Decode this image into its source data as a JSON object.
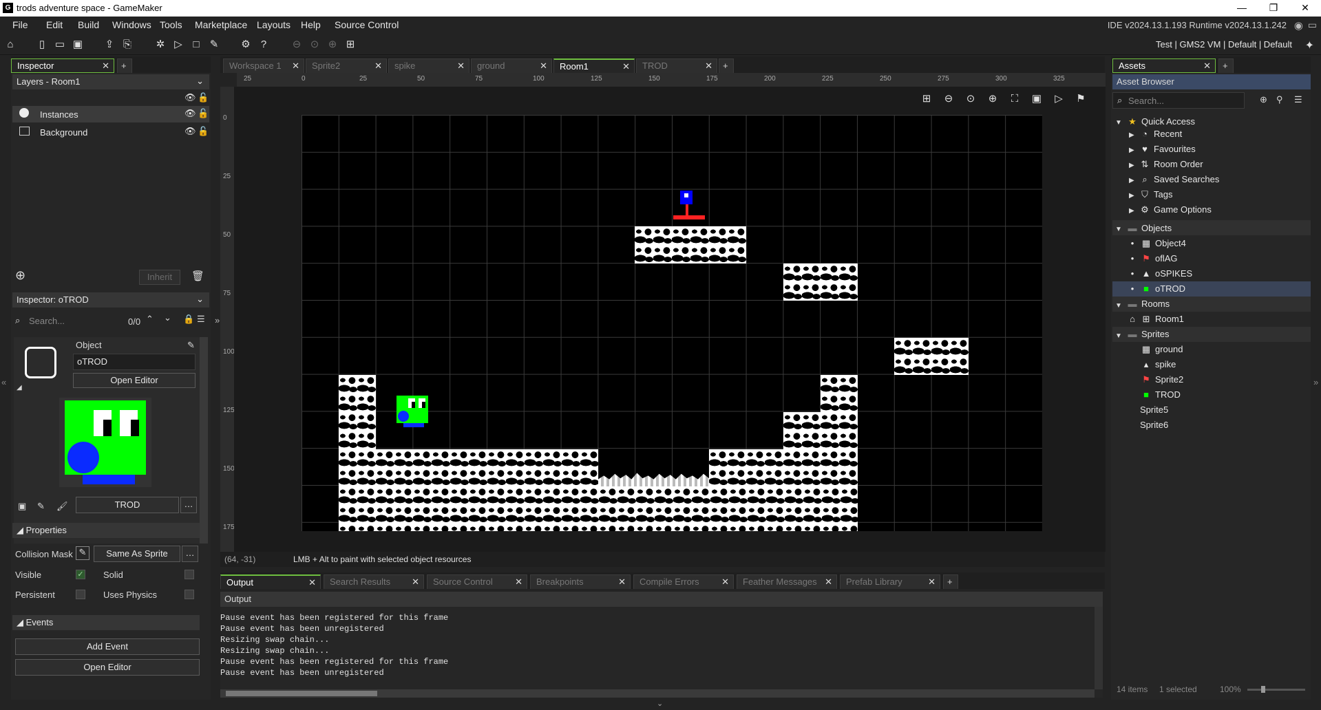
{
  "window": {
    "title": "trods adventure space - GameMaker",
    "logo": "gm-logo",
    "min": "—",
    "max": "❐",
    "close": "✕"
  },
  "menu": [
    "File",
    "Edit",
    "Build",
    "Windows",
    "Tools",
    "Marketplace",
    "Layouts",
    "Help",
    "Source Control"
  ],
  "version": "IDE v2024.13.1.193  Runtime v2024.13.1.242",
  "target": "Test | GMS2 VM | Default | Default",
  "left": {
    "tab": "Inspector",
    "layers_dropdown": "Layers - Room1",
    "layers": [
      "Instances",
      "Background"
    ],
    "inherit": "Inherit",
    "inspector_dropdown": "Inspector: oTROD",
    "search_placeholder": "Search...",
    "search_count": "0/0",
    "object_label": "Object",
    "object_name": "oTROD",
    "open_editor": "Open Editor",
    "sprite_name": "TROD",
    "properties": "Properties",
    "collision_mask": "Collision Mask",
    "same_as_sprite": "Same As Sprite",
    "visible": "Visible",
    "solid": "Solid",
    "persistent": "Persistent",
    "uses_physics": "Uses Physics",
    "events": "Events",
    "add_event": "Add Event",
    "open_editor2": "Open Editor"
  },
  "center": {
    "tabs": [
      "Workspace 1",
      "Sprite2",
      "spike",
      "ground",
      "Room1",
      "TROD"
    ],
    "active_tab": "Room1",
    "ruler_h": [
      "25",
      "0",
      "25",
      "50",
      "75",
      "100",
      "125",
      "150",
      "175",
      "200",
      "225",
      "250",
      "275",
      "300",
      "325"
    ],
    "ruler_v": [
      "0",
      "25",
      "50",
      "75",
      "100",
      "125",
      "150",
      "175"
    ],
    "status_coords": "(64, -31)",
    "status_hint": "LMB + Alt to paint with selected object resources"
  },
  "output": {
    "tabs": [
      "Output",
      "Search Results",
      "Source Control",
      "Breakpoints",
      "Compile Errors",
      "Feather Messages",
      "Prefab Library"
    ],
    "header": "Output",
    "lines": [
      "Pause event has been registered for this frame",
      "Pause event has been unregistered",
      "Resizing swap chain...",
      "Resizing swap chain...",
      "Pause event has been registered for this frame",
      "Pause event has been unregistered"
    ]
  },
  "assets": {
    "tab": "Assets",
    "browser": "Asset Browser",
    "search_placeholder": "Search...",
    "quick_access": "Quick Access",
    "qa_items": [
      "Recent",
      "Favourites",
      "Room Order",
      "Saved Searches",
      "Tags",
      "Game Options"
    ],
    "objects": "Objects",
    "object_items": [
      "Object4",
      "oflAG",
      "oSPIKES",
      "oTROD"
    ],
    "rooms": "Rooms",
    "room_items": [
      "Room1"
    ],
    "sprites": "Sprites",
    "sprite_items": [
      "ground",
      "spike",
      "Sprite2",
      "TROD"
    ],
    "loose_items": [
      "Sprite5",
      "Sprite6"
    ],
    "footer_count": "14 items",
    "footer_selected": "1 selected",
    "footer_zoom": "100%"
  }
}
